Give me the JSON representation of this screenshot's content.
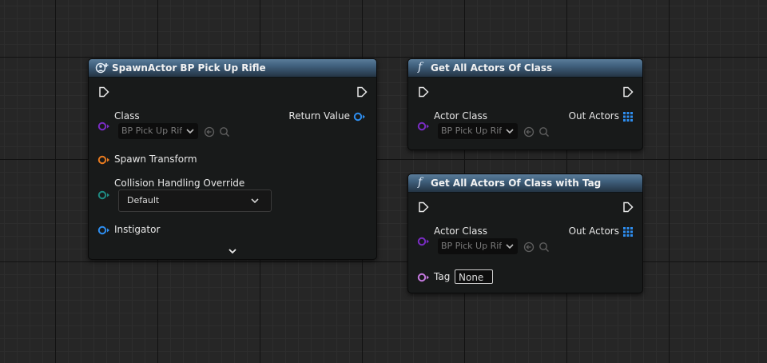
{
  "colors": {
    "exec_pin": "#e8e8e8",
    "class_pin": "#7a2cc4",
    "object_pin": "#2e8ef0",
    "struct_pin": "#e87a1f",
    "enum_pin": "#1f8a82",
    "name_pin": "#c67ae0",
    "header_blue": "#3f5f7c"
  },
  "spawn_node": {
    "title": "SpawnActor BP Pick Up Rifle",
    "icon": "spawn-actor-icon",
    "class_label": "Class",
    "class_value": "BP Pick Up Rifle",
    "return_label": "Return Value",
    "spawn_transform_label": "Spawn Transform",
    "collision_label": "Collision Handling Override",
    "collision_value": "Default",
    "instigator_label": "Instigator",
    "expand_icon": "chevron-down-icon"
  },
  "get_all_node": {
    "title": "Get All Actors Of Class",
    "icon": "function-icon",
    "actor_class_label": "Actor Class",
    "actor_class_value": "BP Pick Up Rifle",
    "out_label": "Out Actors"
  },
  "get_all_tag_node": {
    "title": "Get All Actors Of Class with Tag",
    "icon": "function-icon",
    "actor_class_label": "Actor Class",
    "actor_class_value": "BP Pick Up Rifle",
    "out_label": "Out Actors",
    "tag_label": "Tag",
    "tag_value": "None"
  }
}
